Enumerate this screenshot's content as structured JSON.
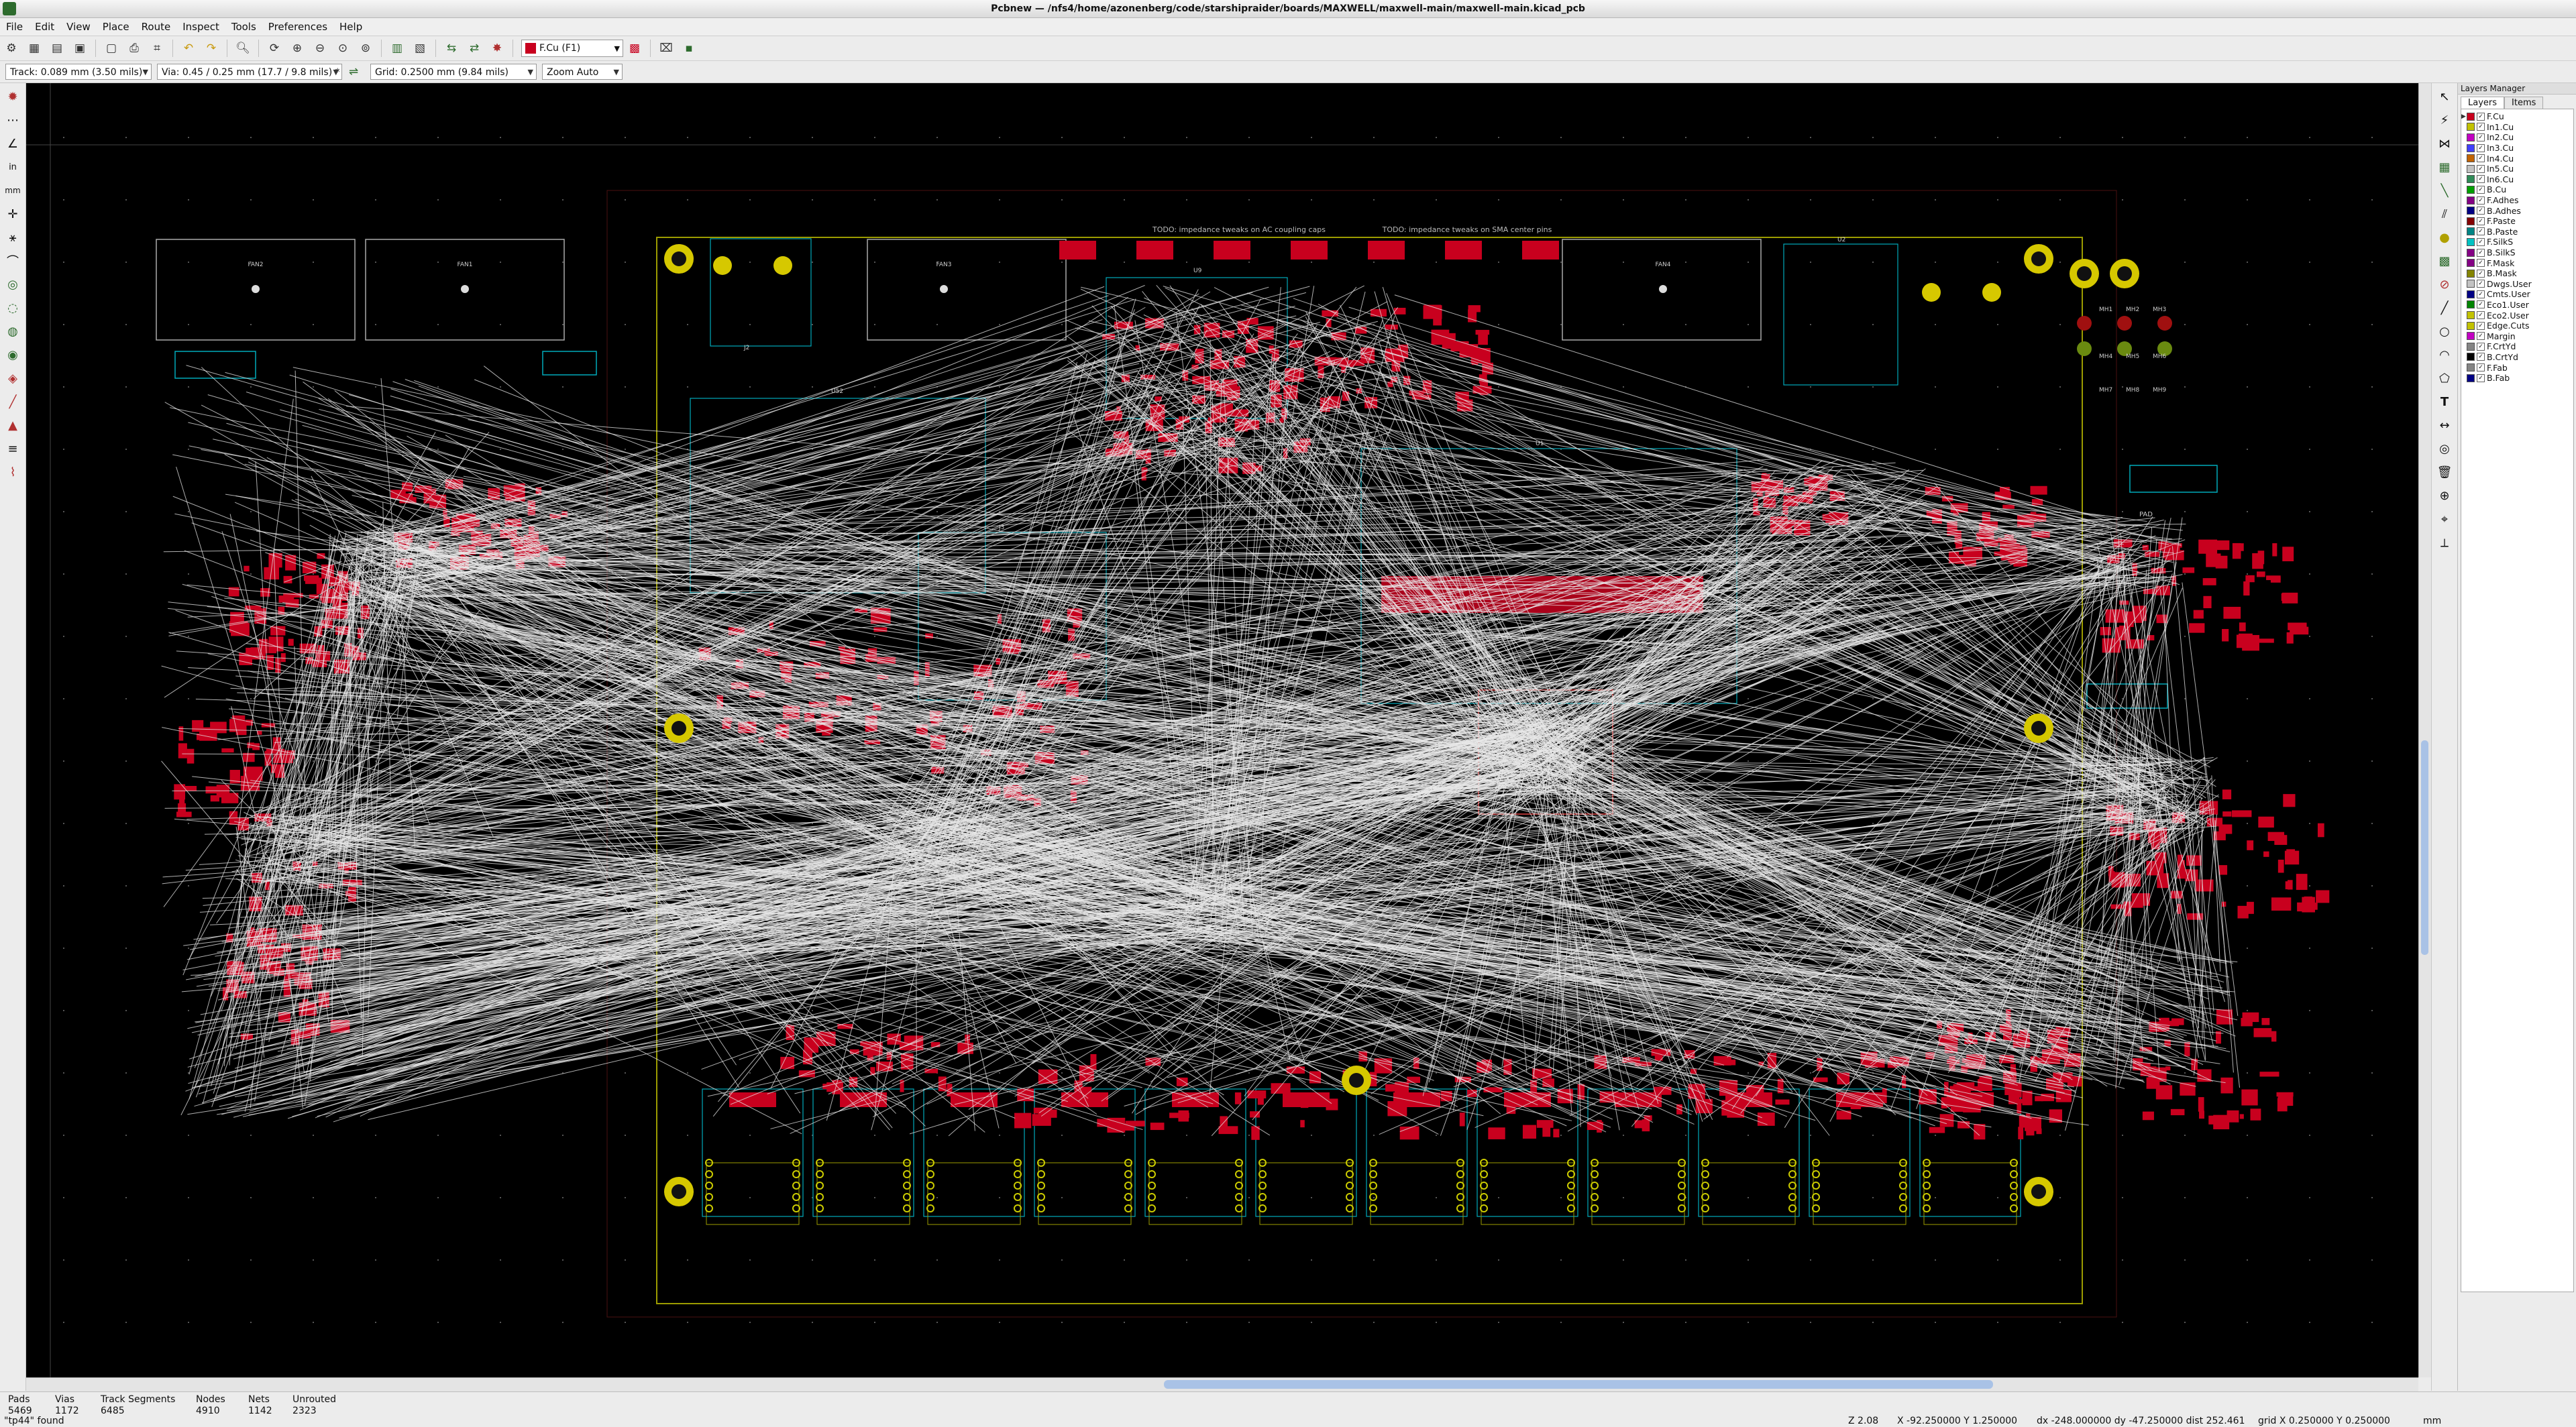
{
  "window": {
    "title": "Pcbnew — /nfs4/home/azonenberg/code/starshipraider/boards/MAXWELL/maxwell-main/maxwell-main.kicad_pcb"
  },
  "menu": [
    "File",
    "Edit",
    "View",
    "Place",
    "Route",
    "Inspect",
    "Tools",
    "Preferences",
    "Help"
  ],
  "toolbar": {
    "layer_selector": "F.Cu (F1)",
    "track_width": "Track: 0.089 mm (3.50 mils)",
    "via_size": "Via: 0.45 / 0.25 mm (17.7 / 9.8 mils) *",
    "grid": "Grid: 0.2500 mm (9.84 mils)",
    "zoom": "Zoom Auto"
  },
  "layers_panel": {
    "title": "Layers Manager",
    "tabs": [
      "Layers",
      "Items"
    ],
    "layers": [
      {
        "name": "F.Cu",
        "color": "#c8001e",
        "active": true
      },
      {
        "name": "In1.Cu",
        "color": "#c2c200"
      },
      {
        "name": "In2.Cu",
        "color": "#c200c2"
      },
      {
        "name": "In3.Cu",
        "color": "#4040ff"
      },
      {
        "name": "In4.Cu",
        "color": "#c26300"
      },
      {
        "name": "In5.Cu",
        "color": "#c2c2c2"
      },
      {
        "name": "In6.Cu",
        "color": "#2e8b57"
      },
      {
        "name": "B.Cu",
        "color": "#00a000"
      },
      {
        "name": "F.Adhes",
        "color": "#840084"
      },
      {
        "name": "B.Adhes",
        "color": "#000084"
      },
      {
        "name": "F.Paste",
        "color": "#840000"
      },
      {
        "name": "B.Paste",
        "color": "#008484"
      },
      {
        "name": "F.SilkS",
        "color": "#00c2c2"
      },
      {
        "name": "B.SilkS",
        "color": "#840084"
      },
      {
        "name": "F.Mask",
        "color": "#840084"
      },
      {
        "name": "B.Mask",
        "color": "#848400"
      },
      {
        "name": "Dwgs.User",
        "color": "#c2c2c2"
      },
      {
        "name": "Cmts.User",
        "color": "#000084"
      },
      {
        "name": "Eco1.User",
        "color": "#008400"
      },
      {
        "name": "Eco2.User",
        "color": "#c2c200"
      },
      {
        "name": "Edge.Cuts",
        "color": "#c2c200"
      },
      {
        "name": "Margin",
        "color": "#c200c2"
      },
      {
        "name": "F.CrtYd",
        "color": "#848484"
      },
      {
        "name": "B.CrtYd",
        "color": "#000000"
      },
      {
        "name": "F.Fab",
        "color": "#848484"
      },
      {
        "name": "B.Fab",
        "color": "#000084"
      }
    ]
  },
  "canvas": {
    "annotations": [
      "TODO: impedance tweaks on AC coupling caps",
      "TODO: impedance tweaks on SMA center pins"
    ],
    "refs": [
      "FAN2",
      "FAN1",
      "FAN3",
      "FAN4",
      "U52",
      "J2",
      "U9",
      "U1",
      "U2",
      "J3",
      "PAD",
      "MH1",
      "MH2",
      "MH3",
      "MH4",
      "MH5",
      "MH6",
      "MH7",
      "MH8",
      "MH9"
    ]
  },
  "status": {
    "pads_label": "Pads",
    "pads": "5469",
    "vias_label": "Vias",
    "vias": "1172",
    "tracks_label": "Track Segments",
    "tracks": "6485",
    "nodes_label": "Nodes",
    "nodes": "4910",
    "nets_label": "Nets",
    "nets": "1142",
    "unrouted_label": "Unrouted",
    "unrouted": "2323",
    "message": "\"tp44\" found",
    "zoom": "Z 2.08",
    "cursor": "X -92.250000  Y 1.250000",
    "delta": "dx -248.000000  dy -47.250000  dist 252.461",
    "grid": "grid X 0.250000  Y 0.250000",
    "units": "mm"
  }
}
